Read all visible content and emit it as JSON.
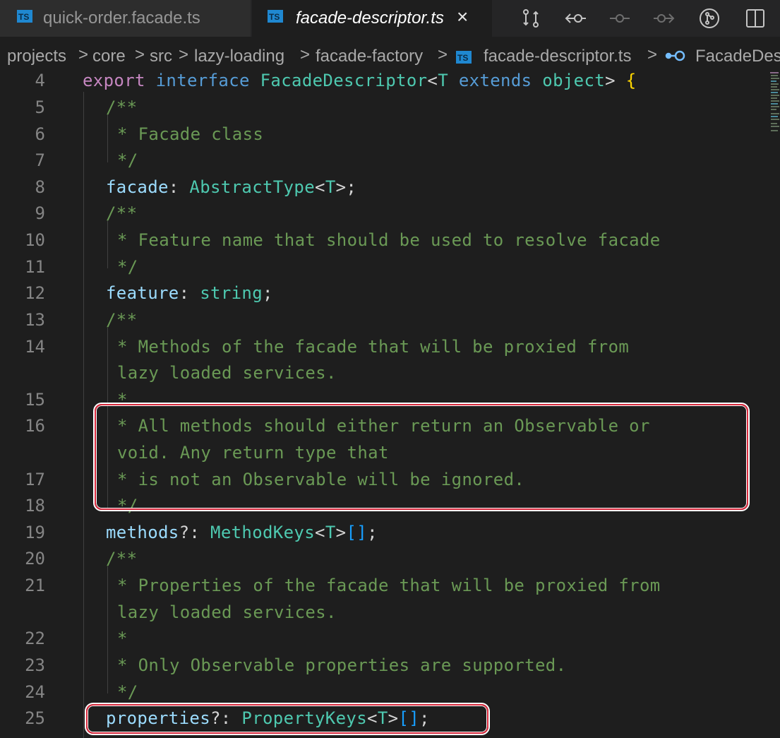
{
  "tabs": [
    {
      "label": "quick-order.facade.ts",
      "icon": "TS",
      "active": false
    },
    {
      "label": "facade-descriptor.ts",
      "icon": "TS",
      "active": true,
      "close": "×"
    }
  ],
  "toolbar": {
    "icons": [
      "compare-changes-icon",
      "previous-change-icon",
      "current-change-icon",
      "next-change-icon",
      "git-commit-icon",
      "split-editor-icon"
    ]
  },
  "breadcrumb": {
    "items": [
      "projects",
      "core",
      "src",
      "lazy-loading",
      "facade-factory",
      "facade-descriptor.ts",
      "FacadeDes"
    ],
    "separator": ">"
  },
  "editor": {
    "lines": [
      {
        "n": "4"
      },
      {
        "n": "5"
      },
      {
        "n": "6"
      },
      {
        "n": "7"
      },
      {
        "n": "8"
      },
      {
        "n": "9"
      },
      {
        "n": "10"
      },
      {
        "n": "11"
      },
      {
        "n": "12"
      },
      {
        "n": "13"
      },
      {
        "n": "14"
      },
      {
        "n": ""
      },
      {
        "n": "15"
      },
      {
        "n": "16"
      },
      {
        "n": ""
      },
      {
        "n": "17"
      },
      {
        "n": "18"
      },
      {
        "n": "19"
      },
      {
        "n": "20"
      },
      {
        "n": "21"
      },
      {
        "n": ""
      },
      {
        "n": "22"
      },
      {
        "n": "23"
      },
      {
        "n": "24"
      },
      {
        "n": "25"
      }
    ],
    "code": {
      "l4": {
        "export": "export",
        "interface": "interface",
        "name": "FacadeDescriptor",
        "lt": "<",
        "T": "T",
        "extends": "extends",
        "object": "object",
        "gt": ">",
        "brace": "{"
      },
      "c_open": "/**",
      "c_close": "*/",
      "l6": "* Facade class",
      "l8": {
        "prop": "facade",
        "colon": ": ",
        "type": "AbstractType",
        "lt": "<",
        "T": "T",
        "end": ">;"
      },
      "l10": "* Feature name that should be used to resolve facade",
      "l12": {
        "prop": "feature",
        "colon": ": ",
        "type": "string",
        "end": ";"
      },
      "l14a": "* Methods of the facade that will be proxied from",
      "l14b": "lazy loaded services.",
      "l15": "*",
      "l16a": "* All methods should either return an Observable or",
      "l16b": "void. Any return type that",
      "l17": "* is not an Observable will be ignored.",
      "l19": {
        "prop": "methods",
        "q": "?: ",
        "type": "MethodKeys",
        "lt": "<",
        "T": "T",
        "gt": ">",
        "arr": "[]",
        "end": ";"
      },
      "l21a": "* Properties of the facade that will be proxied from",
      "l21b": "lazy loaded services.",
      "l22": "*",
      "l23": "* Only Observable properties are supported.",
      "l25": {
        "prop": "properties",
        "q": "?: ",
        "type": "PropertyKeys",
        "lt": "<",
        "T": "T",
        "gt": ">",
        "arr": "[]",
        "end": ";"
      }
    }
  },
  "colors": {
    "highlight": "#d8283c",
    "comment": "#6a9955",
    "type": "#4ec9b0",
    "property": "#9cdcfe"
  }
}
